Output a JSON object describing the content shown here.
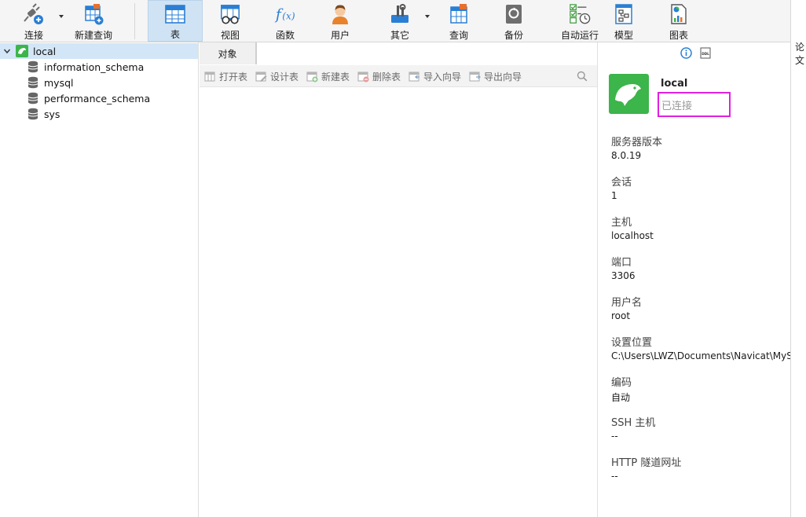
{
  "toolbar": {
    "connect": "连接",
    "new_query": "新建查询",
    "table": "表",
    "view": "视图",
    "function": "函数",
    "user": "用户",
    "others": "其它",
    "query": "查询",
    "backup": "备份",
    "automation": "自动运行",
    "model": "模型",
    "chart": "图表"
  },
  "tree": {
    "connection": "local",
    "databases": [
      "information_schema",
      "mysql",
      "performance_schema",
      "sys"
    ]
  },
  "tabs": {
    "objects": "对象"
  },
  "actions": {
    "open_table": "打开表",
    "design_table": "设计表",
    "new_table": "新建表",
    "delete_table": "删除表",
    "import_wizard": "导入向导",
    "export_wizard": "导出向导"
  },
  "info": {
    "name": "local",
    "status": "已连接",
    "props": [
      {
        "label": "服务器版本",
        "value": "8.0.19"
      },
      {
        "label": "会话",
        "value": "1"
      },
      {
        "label": "主机",
        "value": "localhost"
      },
      {
        "label": "端口",
        "value": "3306"
      },
      {
        "label": "用户名",
        "value": "root"
      },
      {
        "label": "设置位置",
        "value": "C:\\Users\\LWZ\\Documents\\Navicat\\MyS"
      },
      {
        "label": "编码",
        "value": "自动"
      },
      {
        "label": "SSH 主机",
        "value": "--"
      },
      {
        "label": "HTTP 隧道网址",
        "value": "--"
      }
    ]
  },
  "edge": {
    "text": "论文"
  },
  "colors": {
    "accent": "#2a7fd4",
    "highlight": "#e020e0",
    "mysql_green": "#3cb54a",
    "selected": "#cfe3f5"
  }
}
